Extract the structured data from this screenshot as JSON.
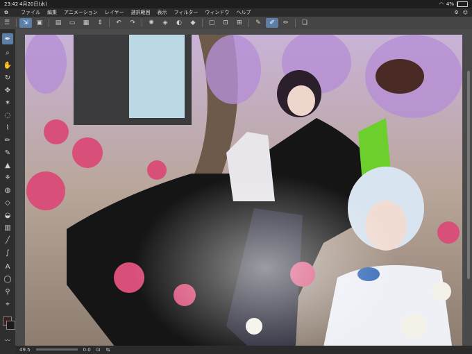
{
  "status": {
    "time": "23:42",
    "date": "4月20日(水)",
    "battery": "4%"
  },
  "menu": {
    "items": [
      "ファイル",
      "編集",
      "アニメーション",
      "レイヤー",
      "選択範囲",
      "表示",
      "フィルター",
      "ウィンドウ",
      "ヘルプ"
    ]
  },
  "bottom": {
    "zoom": "49.5",
    "angle": "0.0"
  },
  "colors": {
    "accent": "#5b7fa6",
    "main_color": "#1b1b1b",
    "sub_color": "#3a2020"
  },
  "icons": {
    "toolbar": [
      "menu-icon",
      "select-tool-icon",
      "canvas-icon",
      "new-file-icon",
      "open-icon",
      "save-icon",
      "undo-icon",
      "redo-icon",
      "spinner-icon",
      "transform-icon",
      "fill-icon",
      "clear-icon",
      "cut-icon",
      "deselect-icon",
      "pen-icon",
      "brush-icon",
      "eraser-icon",
      "layer-icon"
    ],
    "left": [
      "pen-icon",
      "zoom-icon",
      "hand-icon",
      "rotate-icon",
      "move-icon",
      "wand-icon",
      "lasso-icon",
      "eyedropper-icon",
      "pencil-icon",
      "brush-icon",
      "fill-icon",
      "airbrush-icon",
      "blend-icon",
      "eraser-icon",
      "bucket-icon",
      "gradient-icon",
      "line-icon",
      "curve-icon",
      "text-icon",
      "balloon-icon",
      "ruler-icon",
      "operation-icon"
    ]
  }
}
